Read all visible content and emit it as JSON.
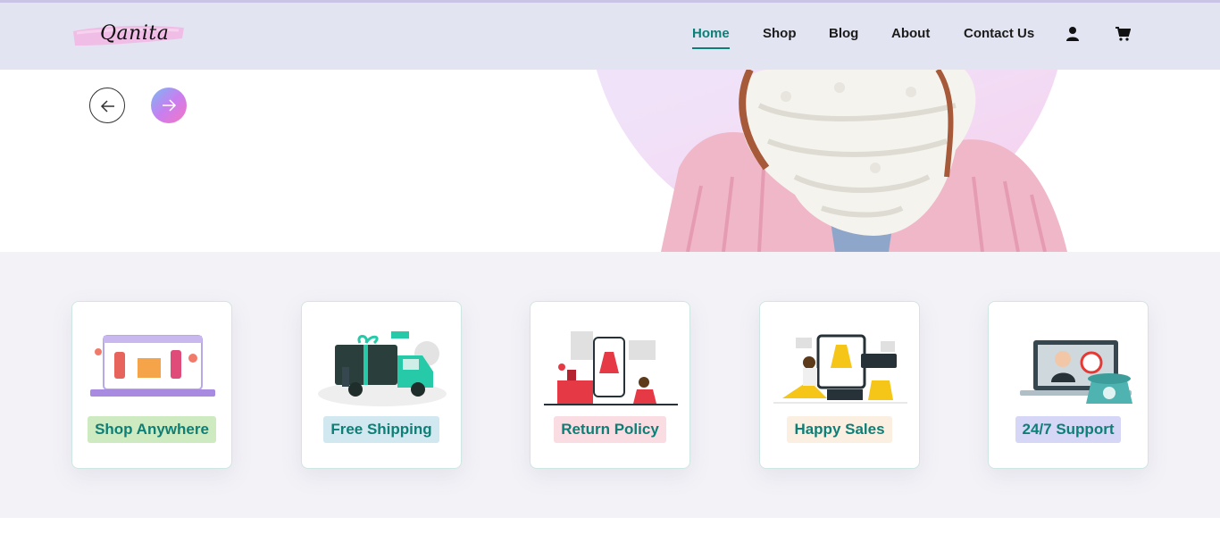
{
  "brand": {
    "logo_text": "Qanita"
  },
  "nav": {
    "items": [
      {
        "label": "Home",
        "active": true
      },
      {
        "label": "Shop",
        "active": false
      },
      {
        "label": "Blog",
        "active": false
      },
      {
        "label": "About",
        "active": false
      },
      {
        "label": "Contact Us",
        "active": false
      }
    ],
    "icons": [
      "user-icon",
      "cart-icon"
    ]
  },
  "hero": {
    "prev_icon": "arrow-left-icon",
    "next_icon": "arrow-right-icon"
  },
  "features": [
    {
      "label": "Shop Anywhere",
      "badge_color": "#cdeac0"
    },
    {
      "label": "Free Shipping",
      "badge_color": "#d2e8f0"
    },
    {
      "label": "Return Policy",
      "badge_color": "#fadce3"
    },
    {
      "label": "Happy Sales",
      "badge_color": "#fbefe2"
    },
    {
      "label": "24/7 Support",
      "badge_color": "#d6d6f7"
    }
  ],
  "colors": {
    "accent": "#0e7f76",
    "header_bg": "#e2e5f1",
    "features_bg": "#f3f2f7"
  }
}
